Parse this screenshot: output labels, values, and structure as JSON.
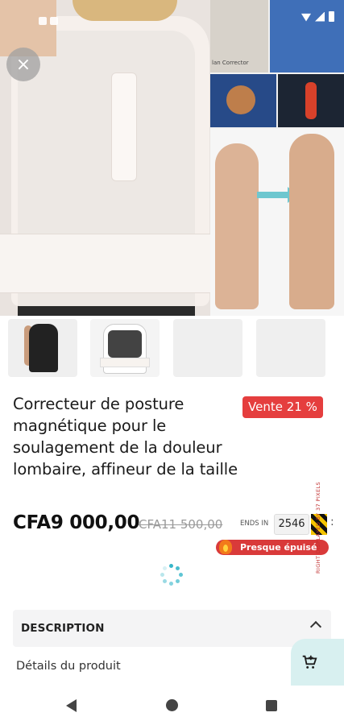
{
  "hero": {
    "close_icon": "close-icon",
    "tile_caption": "lan Corrector"
  },
  "thumbnails": [
    {
      "name": "thumb-back-view"
    },
    {
      "name": "thumb-front-view"
    },
    {
      "name": "thumb-placeholder-1"
    },
    {
      "name": "thumb-placeholder-2"
    }
  ],
  "product": {
    "title": "Correcteur de posture magnétique pour le soulagement de la douleur lombaire, affineur de la taille",
    "sale_badge": "Vente 21 %",
    "price": "CFA9 000,00",
    "old_price": "CFA11 500,00",
    "ends_label": "ENDS IN",
    "timer_value": "2546",
    "stock_status": "Presque épuisé",
    "vertical_note": "RIGHT DISPLAYED BY 37 PIXELS"
  },
  "description": {
    "header": "DESCRIPTION",
    "details_link": "Détails du produit"
  },
  "colors": {
    "sale_red": "#e53e3e",
    "accent_teal": "#36b6c9",
    "fab_bg": "#d8f0f0"
  },
  "icons": {
    "cart": "cart-icon",
    "chevron": "chevron-up-icon",
    "spinner": "loading-spinner-icon"
  }
}
